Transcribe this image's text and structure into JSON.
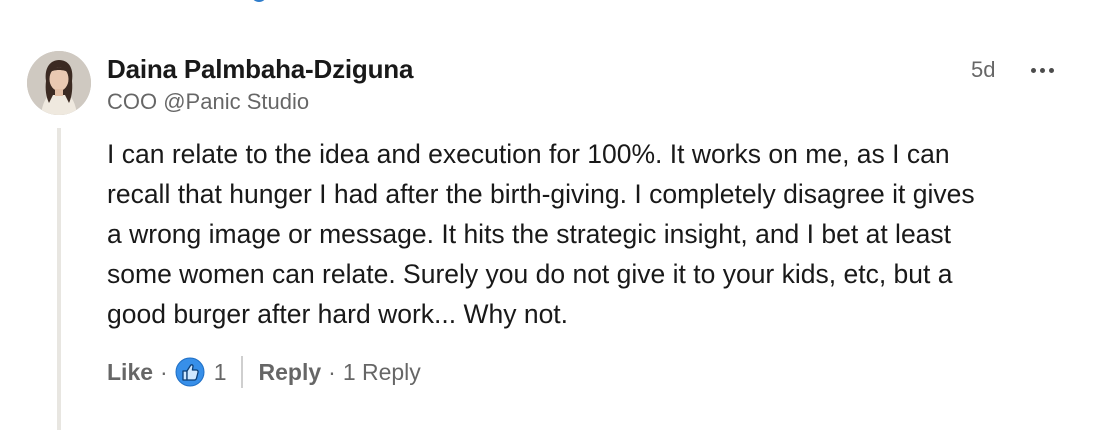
{
  "comment": {
    "author": {
      "name": "Daina Palmbaha-Dziguna",
      "headline": "COO @Panic Studio",
      "avatar": "profile-photo"
    },
    "timestamp": "5d",
    "more_icon": "ellipsis-icon",
    "text": "I can relate to the idea and execution for 100%. It works on me, as I can\nrecall that hunger I had after the birth-giving. I completely disagree it gives\na wrong image or message. It hits the strategic insight, and I bet at least\nsome women can relate. Surely you do not give it to your kids, etc, but a\ngood burger after hard work... Why not.",
    "actions": {
      "like_label": "Like",
      "separator": "·",
      "reaction_icon": "like-reaction-icon",
      "reaction_count": "1",
      "reply_label": "Reply",
      "replies_label": "1 Reply"
    }
  },
  "colors": {
    "like_blue": "#378fe9",
    "brand_blue": "#0a66c2",
    "thread_line": "#e8e6e1"
  }
}
